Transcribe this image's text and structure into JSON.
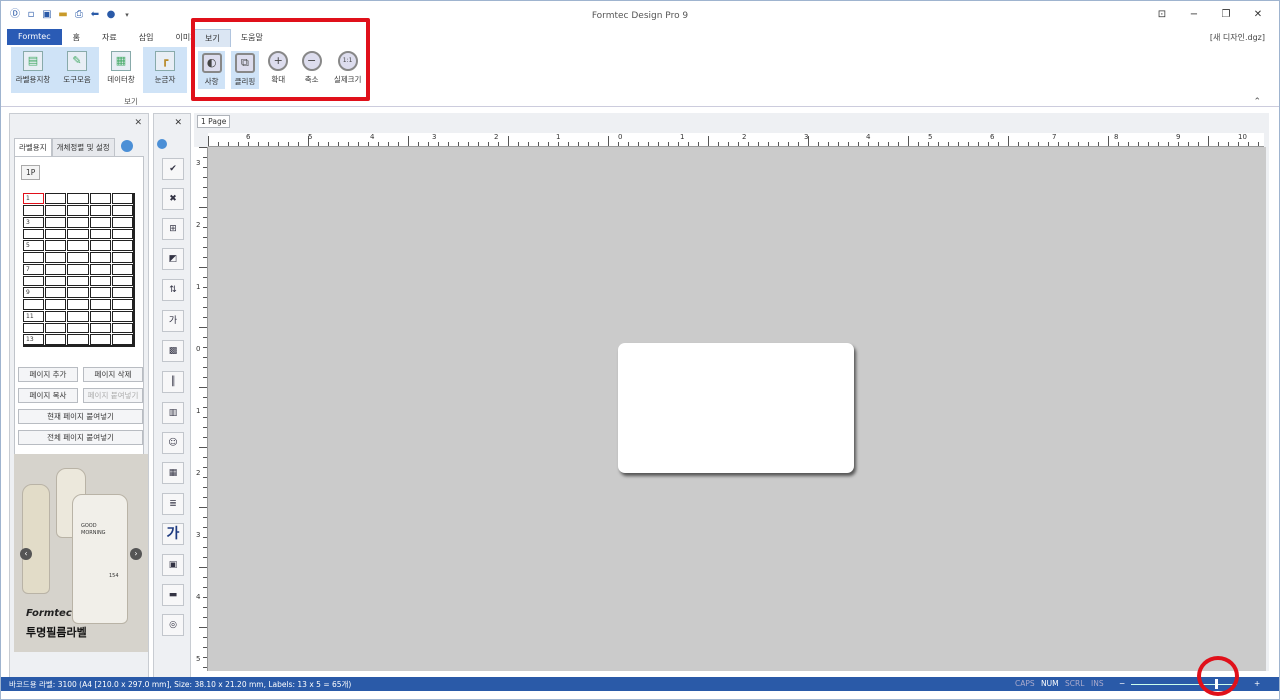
{
  "app": {
    "title": "Formtec Design Pro 9",
    "file_name": "[새 디자인.dgz]"
  },
  "tabs": [
    "Formtec",
    "홈",
    "자료",
    "삽입",
    "이미지"
  ],
  "ribbon": {
    "buttons": [
      "라벨용지창",
      "도구모음",
      "데이터창",
      "눈금자"
    ],
    "group_label": "보기"
  },
  "popup": {
    "tabs": [
      "보기",
      "도움말"
    ],
    "buttons": [
      "사항",
      "클리핑",
      "확대",
      "축소",
      "실제크기"
    ]
  },
  "left_panel": {
    "tabs": [
      "라벨용지",
      "개체정렬 및 설정"
    ],
    "subtab": "1P",
    "row_numbers": [
      "1",
      "3",
      "5",
      "7",
      "9",
      "11",
      "13"
    ],
    "buttons": [
      "페이지 추가",
      "페이지 삭제",
      "페이지 복사",
      "페이지 붙여넣기",
      "현재 페이지 붙여넣기",
      "전체 페이지 붙여넣기"
    ],
    "ad": {
      "brand": "Formtec",
      "title": "투명필름라벨",
      "bottle_text1": "GOOD",
      "bottle_text2": "MORNING",
      "bottle_num": "154"
    }
  },
  "canvas": {
    "page_tab": "1 Page"
  },
  "status": {
    "text": "바코드용 라벨: 3100 (A4 [210.0 x 297.0 mm], Size: 38.10 x 21.20 mm,  Labels: 13 x 5 = 65개)",
    "indicators": [
      "CAPS",
      "NUM",
      "SCRL",
      "INS"
    ],
    "zoom_minus": "−",
    "zoom_plus": "+"
  },
  "colors": {
    "accent": "#2a5aa8",
    "highlight": "#e0101a",
    "workspace": "#cbcbcb"
  },
  "window_controls": [
    "⊡",
    "−",
    "❐",
    "✕"
  ]
}
